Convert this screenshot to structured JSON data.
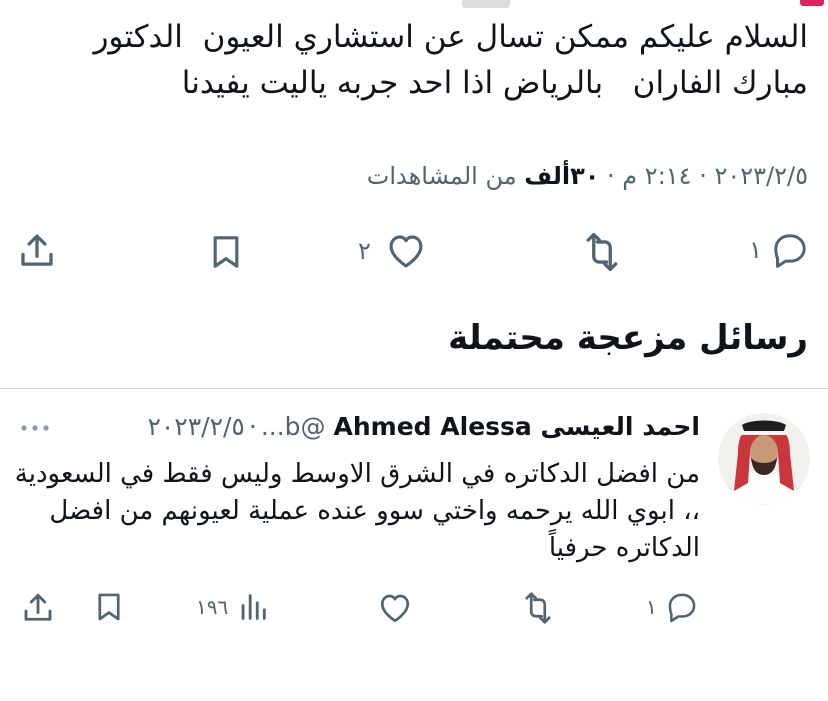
{
  "tweet": {
    "text": "السلام عليكم ممكن تسال عن استشاري العيون  الدكتور مبارك الفاران   بالرياض اذا احد جربه ياليت يفيدنا",
    "date": "٢٠٢٣/٢/٥",
    "time": "٢:١٤ م",
    "views_count": "٣٠ألف",
    "views_label": "من المشاهدات",
    "separator": "·"
  },
  "tweet_actions": {
    "reply_count": "١",
    "retweet_count": "",
    "like_count": "٢"
  },
  "section": {
    "title": "رسائل مزعجة محتملة"
  },
  "reply": {
    "display_name": "احمد العيسى Ahmed Alessa",
    "handle": "@b...",
    "separator": "·",
    "date": "٢٠٢٣/٢/٥",
    "text": "من افضل الدكاتره في الشرق الاوسط وليس فقط في السعودية ،، ابوي الله يرحمه واختي سوو عنده عملية لعيونهم من افضل الدكاتره حرفياً",
    "reply_count": "١",
    "views_count": "١٩٦"
  },
  "colors": {
    "text": "#0f1419",
    "secondary": "#536471",
    "divider": "#cfd9de"
  },
  "icons": [
    "reply-icon",
    "retweet-icon",
    "like-icon",
    "bookmark-icon",
    "share-icon",
    "views-icon",
    "more-icon"
  ]
}
